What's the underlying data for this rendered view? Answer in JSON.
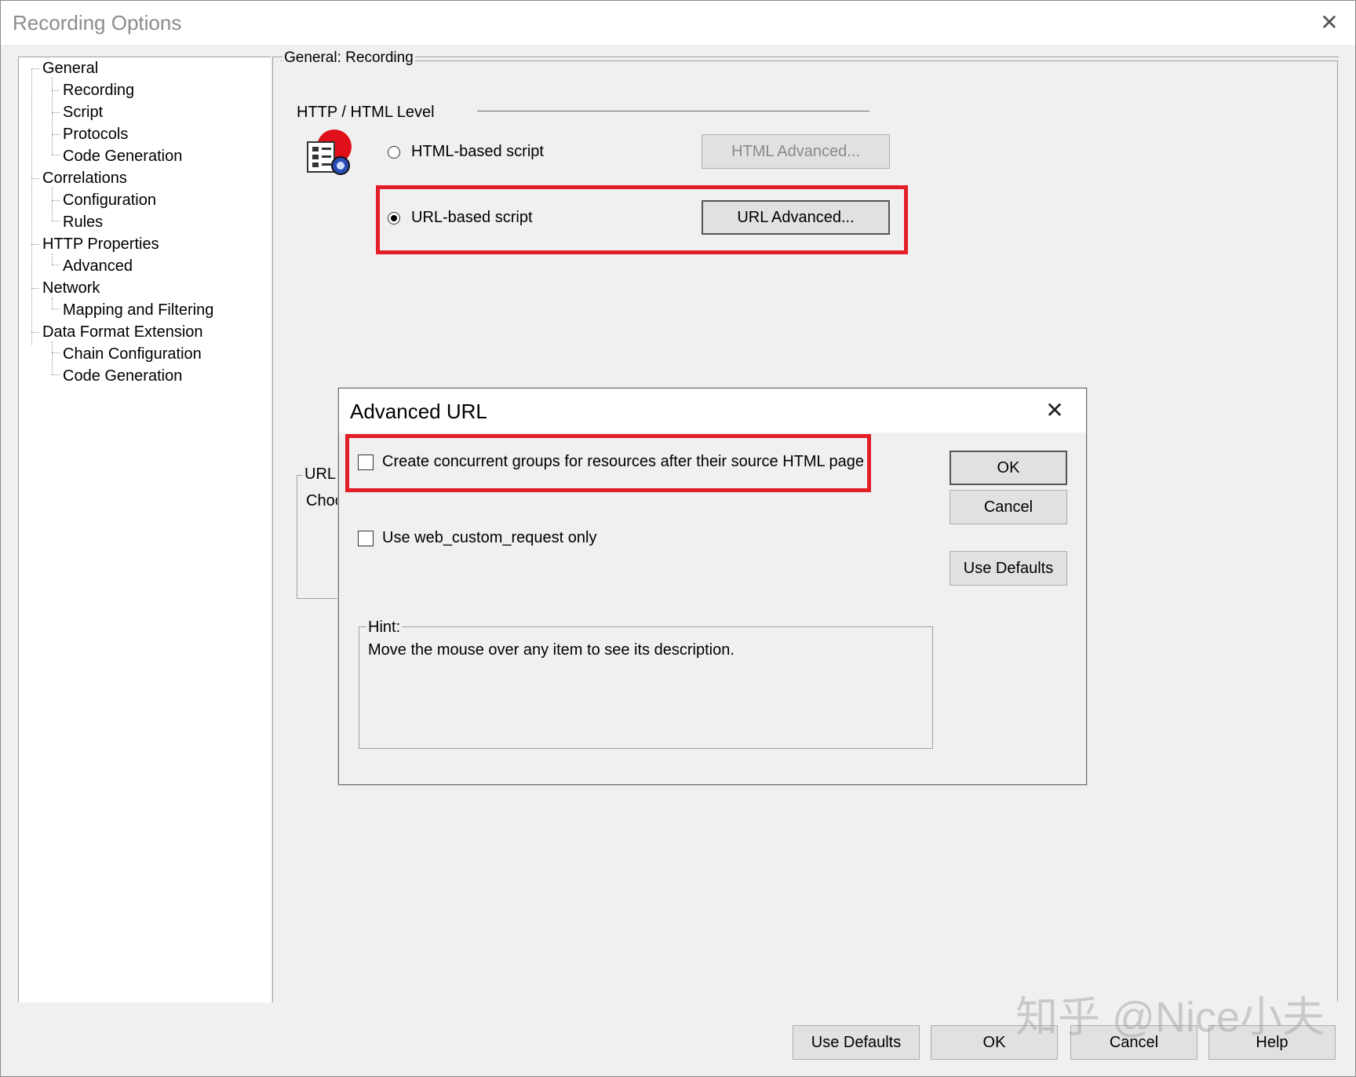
{
  "window": {
    "title": "Recording Options",
    "close_symbol": "✕"
  },
  "tree": {
    "items": [
      {
        "label": "General"
      },
      {
        "label": "Recording"
      },
      {
        "label": "Script"
      },
      {
        "label": "Protocols"
      },
      {
        "label": "Code Generation"
      },
      {
        "label": "Correlations"
      },
      {
        "label": "Configuration"
      },
      {
        "label": "Rules"
      },
      {
        "label": "HTTP Properties"
      },
      {
        "label": "Advanced"
      },
      {
        "label": "Network"
      },
      {
        "label": "Mapping and Filtering"
      },
      {
        "label": "Data Format Extension"
      },
      {
        "label": "Chain Configuration"
      },
      {
        "label": "Code Generation"
      }
    ],
    "selected": "Recording"
  },
  "panel": {
    "group_title": "General: Recording",
    "section_title": "HTTP / HTML Level",
    "html_radio_label": "HTML-based script",
    "html_advanced_label": "HTML Advanced...",
    "url_radio_label": "URL-based script",
    "url_advanced_label": "URL Advanced...",
    "url_group_partial": "URL",
    "url_group_text_partial": "Choc"
  },
  "dialog": {
    "title": "Advanced URL",
    "close_symbol": "✕",
    "checkbox1_label": "Create concurrent groups for resources after their source HTML page",
    "checkbox2_label": "Use web_custom_request only",
    "ok_label": "OK",
    "cancel_label": "Cancel",
    "defaults_label": "Use Defaults",
    "hint_title": "Hint:",
    "hint_text": "Move the mouse over any item to see its description."
  },
  "footer": {
    "use_defaults_label": "Use Defaults",
    "ok_label": "OK",
    "cancel_label": "Cancel",
    "help_label": "Help"
  },
  "watermark": "知乎 @Nice小夫",
  "colors": {
    "highlight_red": "#e41e26",
    "dialog_bg": "#f0f0f0"
  }
}
